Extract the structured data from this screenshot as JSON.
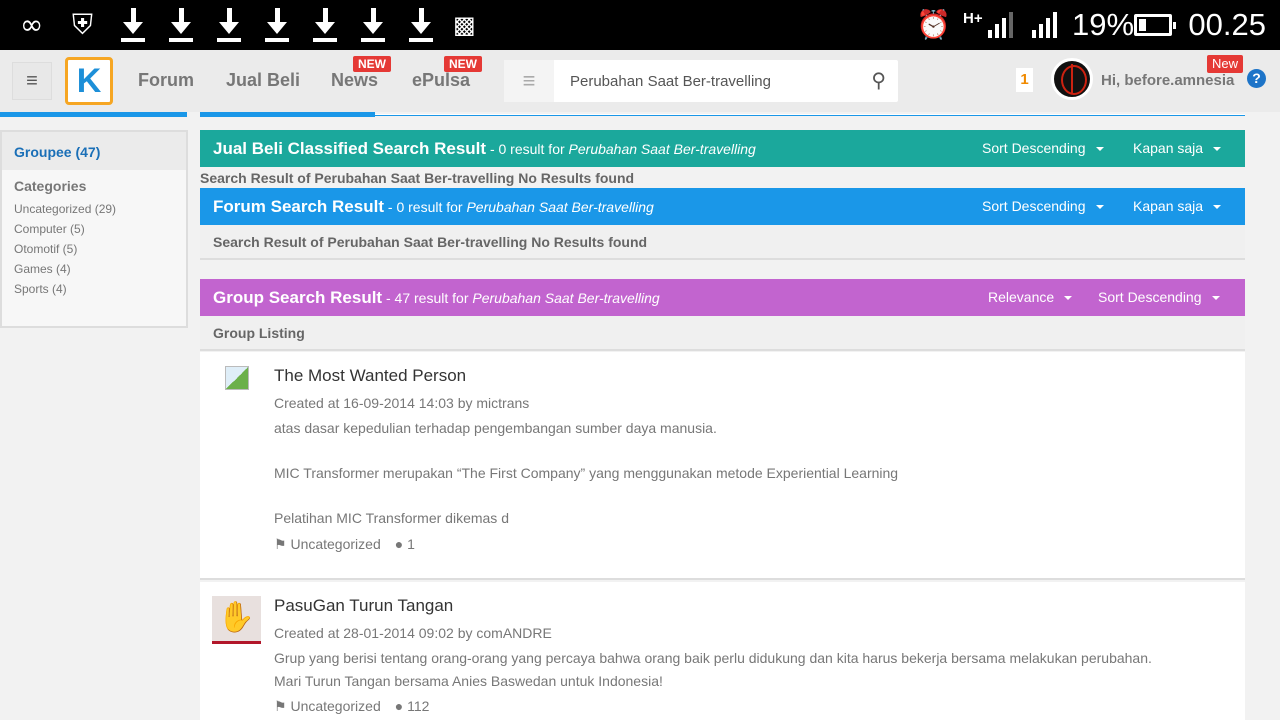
{
  "status_bar": {
    "battery_percent": "19%",
    "time": "00.25",
    "network": "H+",
    "battery_level": 0.19
  },
  "nav": {
    "menu_icon": "hamburger-icon",
    "logo": "K",
    "links": [
      {
        "label": "Forum"
      },
      {
        "label": "Jual Beli"
      },
      {
        "label": "News",
        "badge": "NEW"
      },
      {
        "label": "ePulsa",
        "badge": "NEW"
      }
    ],
    "search": {
      "value": "Perubahan Saat Ber-travelling",
      "placeholder": ""
    },
    "notification_count": "1",
    "greeting": "Hi, before.amnesia",
    "new_badge": "New",
    "help": "?"
  },
  "sidebar": {
    "group_title": "Groupee (47)",
    "categories_title": "Categories",
    "categories": [
      "Uncategorized (29)",
      "Computer (5)",
      "Otomotif (5)",
      "Games (4)",
      "Sports (4)"
    ]
  },
  "sections": {
    "jualbeli": {
      "title": "Jual Beli Classified Search Result",
      "subtitle_prefix": " - 0 result for ",
      "query": "Perubahan Saat Ber-travelling",
      "sort": "Sort Descending",
      "time": "Kapan saja",
      "note": "Search Result of Perubahan Saat Ber-travelling No Results found",
      "color": "#1ba89c"
    },
    "forum": {
      "title": "Forum Search Result",
      "subtitle_prefix": " - 0 result for ",
      "query": "Perubahan Saat Ber-travelling",
      "sort": "Sort Descending",
      "time": "Kapan saja",
      "note": "Search Result of Perubahan Saat Ber-travelling No Results found",
      "color": "#1a97e8"
    },
    "group": {
      "title": "Group Search Result",
      "subtitle_prefix": " - 47 result for ",
      "query": "Perubahan Saat Ber-travelling",
      "relevance": "Relevance",
      "sort": "Sort Descending",
      "listing": "Group Listing",
      "color": "#c264cf"
    }
  },
  "groups": [
    {
      "title": "The Most Wanted Person",
      "created": "Created at 16-09-2014 14:03 by mictrans",
      "desc": [
        "atas dasar kepedulian terhadap pengembangan sumber daya manusia.",
        "MIC Transformer merupakan “The First Company” yang menggunakan metode Experiential Learning",
        "Pelatihan MIC Transformer dikemas d"
      ],
      "category": "Uncategorized",
      "members": "1"
    },
    {
      "title": "PasuGan Turun Tangan",
      "created": "Created at 28-01-2014 09:02 by comANDRE",
      "desc": [
        "Grup yang berisi tentang orang-orang yang percaya bahwa orang baik perlu didukung dan kita harus bekerja bersama melakukan perubahan.",
        "Mari Turun Tangan bersama Anies Baswedan untuk Indonesia!"
      ],
      "category": "Uncategorized",
      "members": "112"
    }
  ]
}
